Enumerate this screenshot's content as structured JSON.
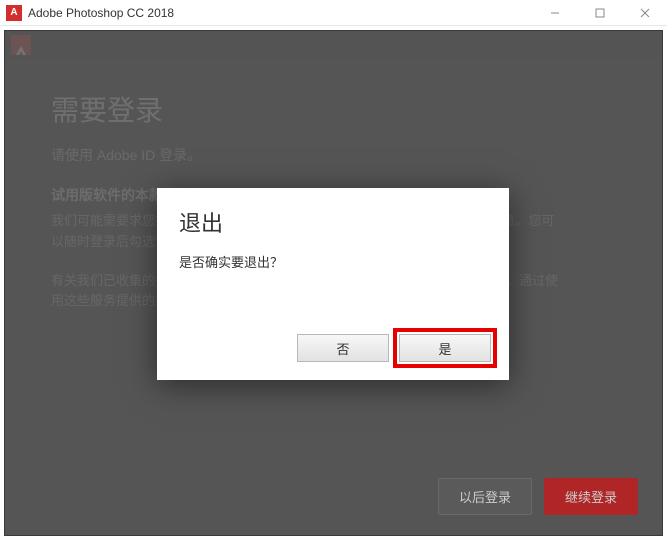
{
  "titlebar": {
    "title": "Adobe Photoshop CC 2018"
  },
  "background": {
    "heading": "需要登录",
    "subtitle": "请使用 Adobe ID 登录。",
    "bold_line": "试用版软件的本款和条件。",
    "line1": "我们可能需要求您提供附加的个人信息，并向您发送与 Adobe ID 相关的营销信息。您可以随时登录后勾选\"隐私设置\"关闭这方面的内容。",
    "line2": "有关我们已收集的关于产品和成员资格的信息和使用方法，请参阅我们隐私政策。通过使用这些服务提供的共享进行作品管理的信息，请参阅我们的隐私声明。",
    "btn_later": "以后登录",
    "btn_login": "继续登录"
  },
  "dialog": {
    "title": "退出",
    "message": "是否确实要退出？",
    "btn_no": "否",
    "btn_yes": "是"
  }
}
